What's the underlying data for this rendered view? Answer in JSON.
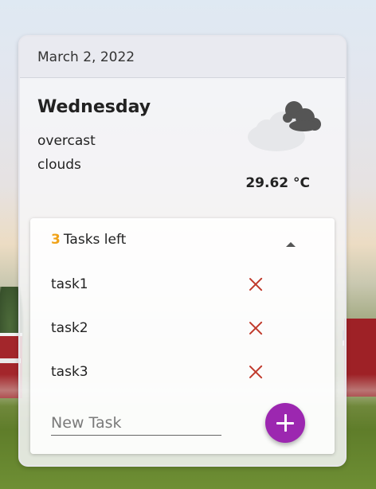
{
  "card": {
    "date": "March 2, 2022",
    "weather": {
      "day": "Wednesday",
      "description_line1": "overcast",
      "description_line2": "clouds",
      "icon": "overcast-clouds-icon",
      "temperature": "29.62 °C"
    }
  },
  "tasks": {
    "count": "3",
    "label": "Tasks left",
    "items": [
      {
        "name": "task1"
      },
      {
        "name": "task2"
      },
      {
        "name": "task3"
      }
    ],
    "new_task_placeholder": "New Task",
    "add_button_icon": "plus-icon",
    "accent_color": "#f0a218",
    "delete_color": "#c0392b",
    "add_button_color": "#9c27b0"
  }
}
